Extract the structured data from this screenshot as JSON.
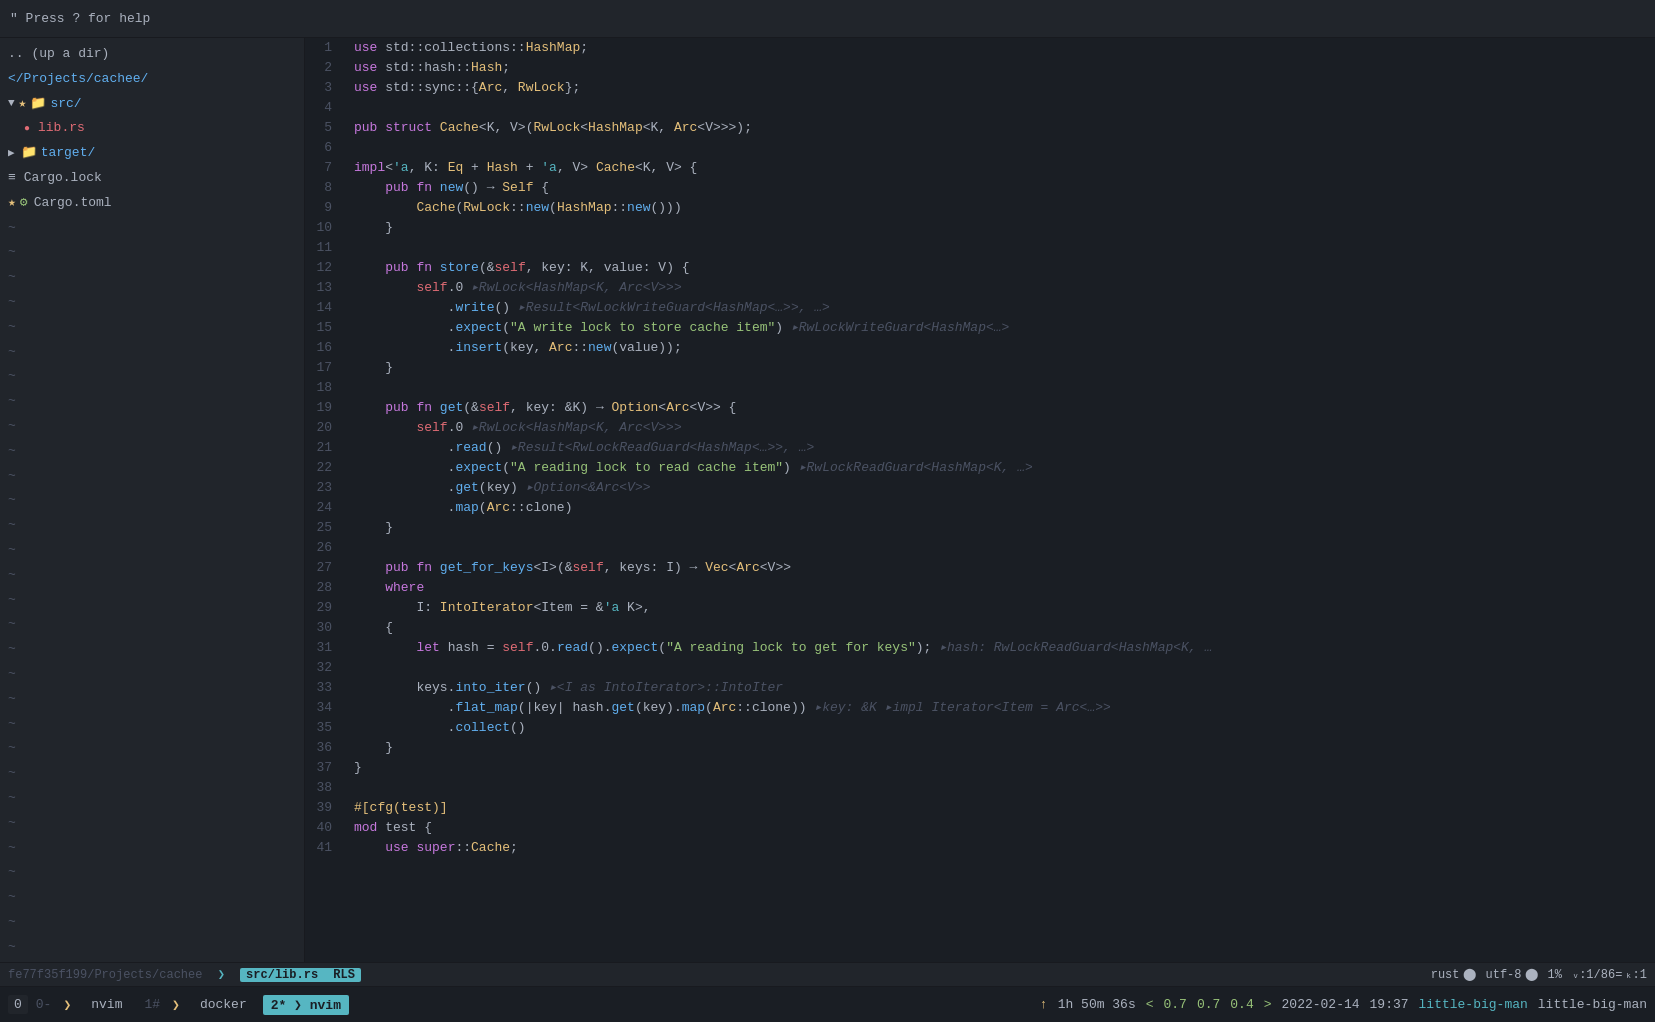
{
  "help_bar": {
    "text": "\" Press ? for help"
  },
  "sidebar": {
    "items": [
      {
        "id": "up-dir",
        "label": ".. (up a dir)",
        "indent": 0,
        "icon": "..",
        "type": "nav"
      },
      {
        "id": "projects-cachee",
        "label": "</Projects/cachee/",
        "indent": 0,
        "icon": "",
        "type": "dir"
      },
      {
        "id": "src-dir",
        "label": "src/",
        "indent": 0,
        "icon": "▼ ★ 📁",
        "type": "dir",
        "expanded": true
      },
      {
        "id": "lib-rs",
        "label": "lib.rs",
        "indent": 1,
        "icon": "🔴",
        "type": "rust"
      },
      {
        "id": "target-dir",
        "label": "target/",
        "indent": 0,
        "icon": "▶ 📁",
        "type": "dir",
        "expanded": false
      },
      {
        "id": "cargo-lock",
        "label": "Cargo.lock",
        "indent": 0,
        "icon": "≡",
        "type": "file"
      },
      {
        "id": "cargo-toml",
        "label": "Cargo.toml",
        "indent": 0,
        "icon": "★ ⚙",
        "type": "config"
      }
    ]
  },
  "editor": {
    "filename": "src/lib.rs",
    "lsp": "RLS",
    "lines": [
      {
        "n": 1,
        "code": "use std::collections::HashMap;"
      },
      {
        "n": 2,
        "code": "use std::hash::Hash;"
      },
      {
        "n": 3,
        "code": "use std::sync::{Arc, RwLock};"
      },
      {
        "n": 4,
        "code": ""
      },
      {
        "n": 5,
        "code": "pub struct Cache<K, V>(RwLock<HashMap<K, Arc<V>>>);"
      },
      {
        "n": 6,
        "code": ""
      },
      {
        "n": 7,
        "code": "impl<'a, K: Eq + Hash + 'a, V> Cache<K, V> {"
      },
      {
        "n": 8,
        "code": "    pub fn new() -> Self {"
      },
      {
        "n": 9,
        "code": "        Cache(RwLock::new(HashMap::new()))"
      },
      {
        "n": 10,
        "code": "    }"
      },
      {
        "n": 11,
        "code": ""
      },
      {
        "n": 12,
        "code": "    pub fn store(&self, key: K, value: V) {"
      },
      {
        "n": 13,
        "code": "        self.0 ▸RwLock<HashMap<K, Arc<V>>>"
      },
      {
        "n": 14,
        "code": "            .write() ▸Result<RwLockWriteGuard<HashMap<...>>, ...>"
      },
      {
        "n": 15,
        "code": "            .expect(\"A write lock to store cache item\") ▸RwLockWriteGuard<HashMap<...>"
      },
      {
        "n": 16,
        "code": "            .insert(key, Arc::new(value));"
      },
      {
        "n": 17,
        "code": "    }"
      },
      {
        "n": 18,
        "code": ""
      },
      {
        "n": 19,
        "code": "    pub fn get(&self, key: &K) -> Option<Arc<V>> {"
      },
      {
        "n": 20,
        "code": "        self.0 ▸RwLock<HashMap<K, Arc<V>>>"
      },
      {
        "n": 21,
        "code": "            .read() ▸Result<RwLockReadGuard<HashMap<...>>, ...>"
      },
      {
        "n": 22,
        "code": "            .expect(\"A reading lock to read cache item\") ▸RwLockReadGuard<HashMap<K, ...>"
      },
      {
        "n": 23,
        "code": "            .get(key) ▸Option<&Arc<V>>"
      },
      {
        "n": 24,
        "code": "            .map(Arc::clone)"
      },
      {
        "n": 25,
        "code": "    }"
      },
      {
        "n": 26,
        "code": ""
      },
      {
        "n": 27,
        "code": "    pub fn get_for_keys<I>(&self, keys: I) -> Vec<Arc<V>>"
      },
      {
        "n": 28,
        "code": "    where"
      },
      {
        "n": 29,
        "code": "        I: IntoIterator<Item = &'a K>,"
      },
      {
        "n": 30,
        "code": "    {"
      },
      {
        "n": 31,
        "code": "        let hash = self.0.read().expect(\"A reading lock to get for keys\"); ▸hash: RwLockReadGuard<HashMap<K, ..."
      },
      {
        "n": 32,
        "code": ""
      },
      {
        "n": 33,
        "code": "        keys.into_iter() ▸<I as IntoIterator>::IntoIter"
      },
      {
        "n": 34,
        "code": "            .flat_map(|key| hash.get(key).map(Arc::clone)) ▸key: &K ▸impl Iterator<Item = Arc<...>>"
      },
      {
        "n": 35,
        "code": "            .collect()"
      },
      {
        "n": 36,
        "code": "    }"
      },
      {
        "n": 37,
        "code": "}"
      },
      {
        "n": 38,
        "code": ""
      },
      {
        "n": 39,
        "code": "#[cfg(test)]"
      },
      {
        "n": 40,
        "code": "mod test {"
      },
      {
        "n": 41,
        "code": "    use super::Cache;"
      }
    ]
  },
  "status_bar": {
    "git": "fe77f35f199/Projects/cachee",
    "git_arrow": "❯",
    "filename": "src/lib.rs",
    "lsp": "RLS",
    "language": "rust",
    "encoding": "utf-8",
    "percent": "1%",
    "position": "ᵥ:1/86=",
    "cursor": "ₖ:1"
  },
  "bottom_bar": {
    "zero": "0",
    "items": [
      {
        "id": "zero-label",
        "label": "0- ❯ nvim",
        "active": false
      },
      {
        "id": "one-label",
        "label": "1#",
        "active": false
      },
      {
        "id": "docker-label",
        "label": "❯ docker",
        "active": false
      },
      {
        "id": "nvim-label",
        "label": "2* ❯ nvim",
        "active": true
      }
    ],
    "arrow": "↑",
    "uptime": "1h 50m 36s",
    "loads": [
      "0.7",
      "0.7",
      "0.4"
    ],
    "date": "2022-02-14",
    "time": "19:37",
    "host": "little-big-man"
  }
}
